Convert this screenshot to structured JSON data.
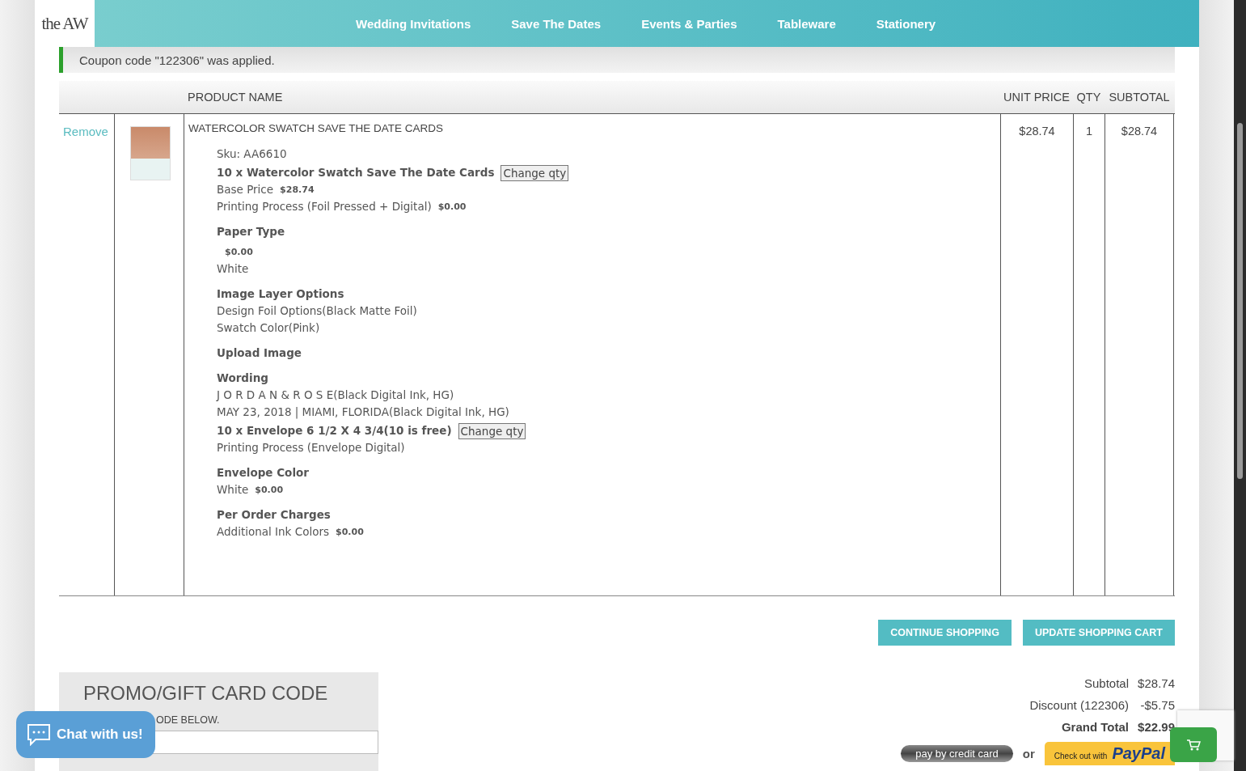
{
  "logo": "the AW",
  "nav": [
    {
      "label": "Wedding Invitations"
    },
    {
      "label": "Save The Dates"
    },
    {
      "label": "Events & Parties"
    },
    {
      "label": "Tableware"
    },
    {
      "label": "Stationery"
    }
  ],
  "message": "Coupon code \"122306\" was applied.",
  "table": {
    "columns": [
      "PRODUCT NAME",
      "UNIT PRICE",
      "QTY",
      "SUBTOTAL"
    ],
    "rows": [
      {
        "remove": "Remove",
        "name": "WATERCOLOR SWATCH SAVE THE DATE CARDS",
        "unit_price": "$28.74",
        "qty": "1",
        "subtotal": "$28.74",
        "details": [
          {
            "kind": "sku",
            "text": "Sku: AA6610"
          },
          {
            "kind": "qty",
            "text": "10 x Watercolor Swatch Save The Date Cards",
            "button": "Change qty"
          },
          {
            "kind": "option",
            "text": "Base Price",
            "price": "$28.74"
          },
          {
            "kind": "option",
            "text": "Printing Process (Foil Pressed + Digital)",
            "price": "$0.00"
          },
          {
            "kind": "heading",
            "text": "Paper Type"
          },
          {
            "kind": "price",
            "price": "$0.00"
          },
          {
            "kind": "option",
            "text": "White"
          },
          {
            "kind": "heading",
            "text": "Image Layer Options"
          },
          {
            "kind": "option",
            "text": "Design Foil Options(Black Matte Foil)"
          },
          {
            "kind": "option",
            "text": "Swatch Color(Pink)"
          },
          {
            "kind": "heading",
            "text": "Upload Image"
          },
          {
            "kind": "heading",
            "text": "Wording"
          },
          {
            "kind": "option",
            "text": "J O R D A N & R O S E(Black Digital Ink, HG)"
          },
          {
            "kind": "option",
            "text": "MAY 23, 2018 | MIAMI, FLORIDA(Black Digital Ink, HG)"
          },
          {
            "kind": "qty",
            "text": "10 x Envelope 6 1/2 X 4 3/4(10 is free)",
            "button": "Change qty"
          },
          {
            "kind": "option",
            "text": "Printing Process (Envelope Digital)"
          },
          {
            "kind": "heading",
            "text": "Envelope Color"
          },
          {
            "kind": "option",
            "text": "White",
            "price": "$0.00"
          },
          {
            "kind": "heading",
            "text": "Per Order Charges"
          },
          {
            "kind": "option",
            "text": "Additional Ink Colors",
            "price": "$0.00"
          }
        ]
      }
    ]
  },
  "actions": [
    "CONTINUE SHOPPING",
    "UPDATE SHOPPING CART"
  ],
  "promo": {
    "title": "PROMO/GIFT CARD CODE",
    "hint": "ODE BELOW."
  },
  "totals": [
    {
      "label": "Subtotal",
      "value": "$28.74",
      "kind": "normal"
    },
    {
      "label": "Discount (122306)",
      "value": "-$5.75",
      "kind": "normal"
    },
    {
      "label": "Grand Total",
      "value": "$22.99",
      "kind": "grand"
    }
  ],
  "checkout": {
    "card": "pay by credit card",
    "or": "or",
    "paypal_prefix": "Check out with",
    "paypal": "PayPal"
  },
  "chat": "Chat with us!"
}
